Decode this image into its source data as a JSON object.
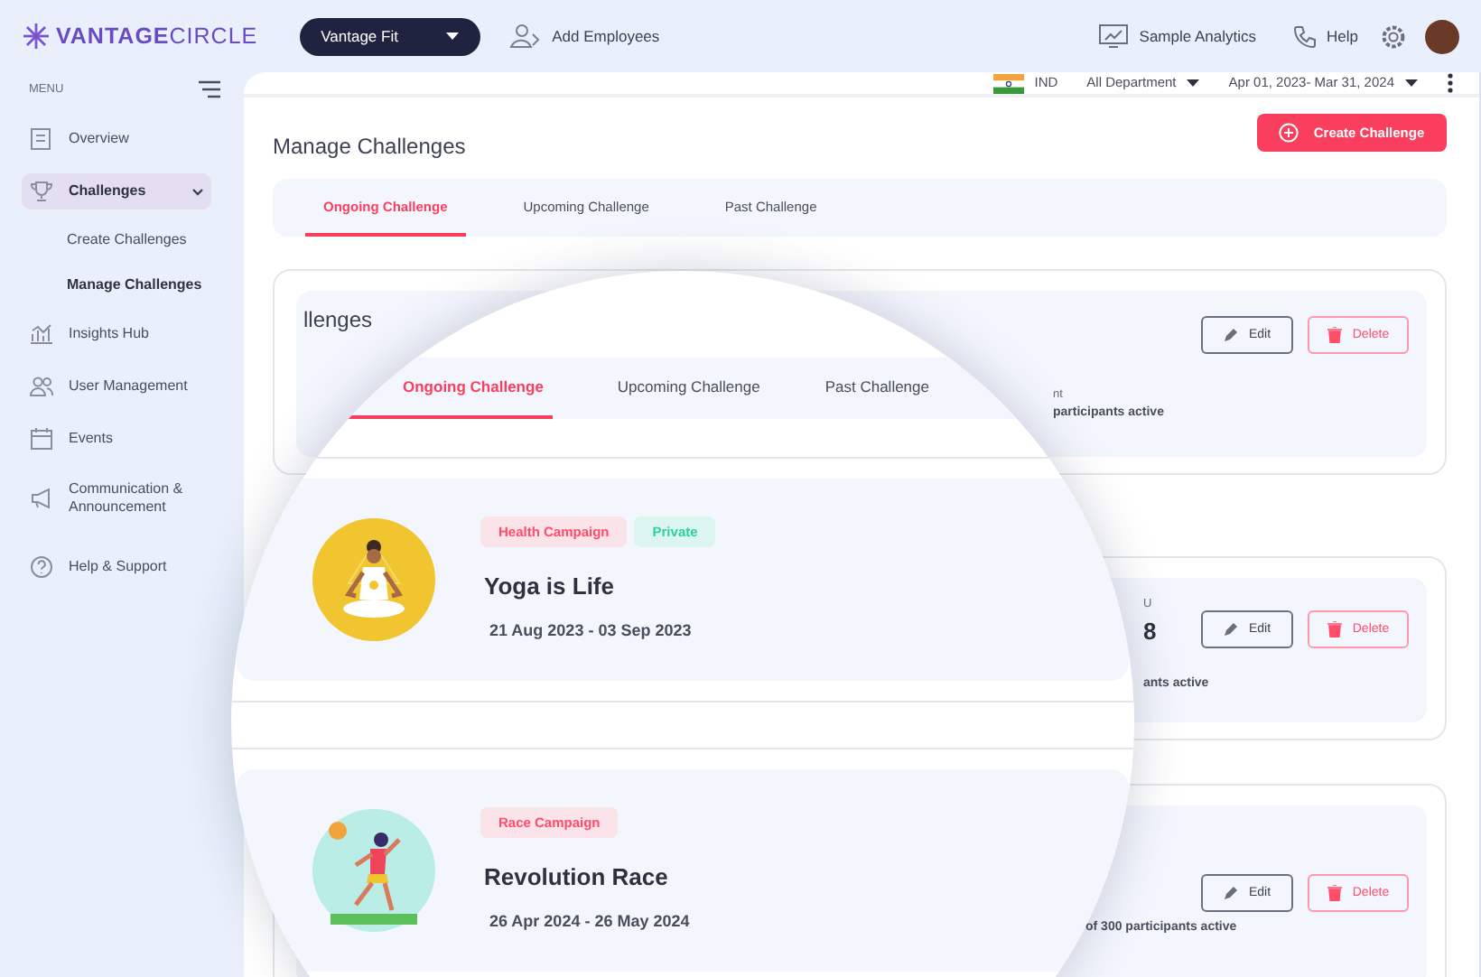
{
  "header": {
    "logo": "**VANTAGE**CIRCLE",
    "product_switch": "Vantage Fit",
    "add_employees": "Add Employees",
    "links": [
      "Sample Analytics",
      "Help"
    ]
  },
  "sidebar": {
    "menu_label": "MENU",
    "items": [
      {
        "label": "Overview",
        "selected": false
      },
      {
        "label": "Challenges",
        "selected": true,
        "expanded": true,
        "children": [
          {
            "label": "Create Challenges",
            "selected": false
          },
          {
            "label": "Manage Challenges",
            "selected": true
          }
        ]
      },
      {
        "label": "Insights Hub",
        "selected": false
      },
      {
        "label": "User Management",
        "selected": false
      },
      {
        "label": "Events",
        "selected": false
      },
      {
        "label": "Communication & Announcement",
        "selected": false
      },
      {
        "label": "Help & Support",
        "selected": false
      }
    ]
  },
  "filters": {
    "country": "IND",
    "department": "All Department",
    "date_range": "Apr 01, 2023- Mar 31, 2024"
  },
  "page": {
    "title": "Manage Challenges",
    "create_button": "Create Challenge",
    "tabs": [
      {
        "label": "Ongoing Challenge",
        "selected": true
      },
      {
        "label": "Upcoming Challenge",
        "selected": false
      },
      {
        "label": "Past Challenge",
        "selected": false
      }
    ],
    "cards": [
      {
        "heading": "llenges",
        "fragments": [
          {
            "text": "nt",
            "kind": "small"
          },
          {
            "text": "participants active",
            "kind": "note"
          }
        ],
        "edit": "Edit",
        "delete": "Delete"
      },
      {
        "fragments": [
          {
            "text": "U",
            "kind": "small"
          },
          {
            "text": "8",
            "kind": "big"
          },
          {
            "text": "ants active",
            "kind": "note"
          }
        ],
        "edit": "Edit",
        "delete": "Delete"
      },
      {
        "fragments": [
          {
            "text": "of 300 participants active",
            "kind": "note"
          }
        ],
        "edit": "Edit",
        "delete": "Delete"
      }
    ]
  },
  "magnifier": {
    "tabs": [
      {
        "label": "Ongoing Challenge",
        "selected": true
      },
      {
        "label": "Upcoming Challenge",
        "selected": false
      },
      {
        "label": "Past Challenge",
        "selected": false
      }
    ],
    "cards": [
      {
        "tags": [
          {
            "text": "Health Campaign",
            "kind": "campaign"
          },
          {
            "text": "Private",
            "kind": "visibility"
          }
        ],
        "title": "Yoga is Life",
        "dates": "21 Aug 2023 - 03 Sep 2023"
      },
      {
        "tags": [
          {
            "text": "Race Campaign",
            "kind": "campaign"
          }
        ],
        "title": "Revolution Race",
        "dates": "26 Apr 2024 - 26 May 2024"
      }
    ]
  }
}
